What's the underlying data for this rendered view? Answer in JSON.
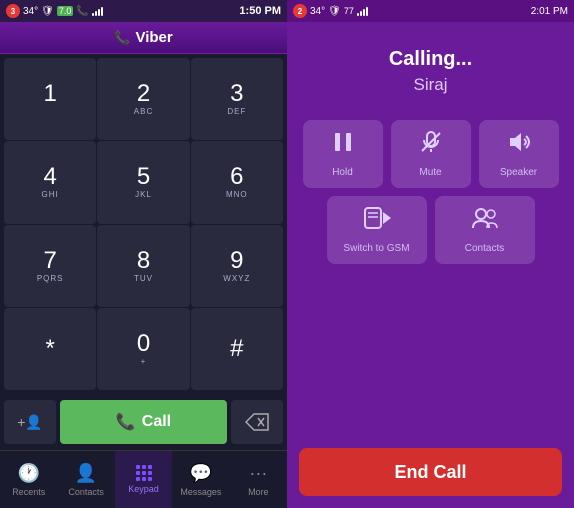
{
  "left": {
    "statusBar": {
      "badge": "3",
      "temp": "34°",
      "shield": "7.0",
      "signal": "full",
      "time": "1:50 PM"
    },
    "header": {
      "appName": "Viber"
    },
    "keypad": {
      "keys": [
        {
          "main": "1",
          "sub": ""
        },
        {
          "main": "2",
          "sub": "ABC"
        },
        {
          "main": "3",
          "sub": "DEF"
        },
        {
          "main": "4",
          "sub": "GHI"
        },
        {
          "main": "5",
          "sub": "JKL"
        },
        {
          "main": "6",
          "sub": "MNO"
        },
        {
          "main": "7",
          "sub": "PQRS"
        },
        {
          "main": "8",
          "sub": "TUV"
        },
        {
          "main": "9",
          "sub": "WXYZ"
        },
        {
          "main": "*",
          "sub": ""
        },
        {
          "main": "0",
          "sub": "+"
        },
        {
          "main": "#",
          "sub": ""
        }
      ]
    },
    "actions": {
      "addContact": "+",
      "call": "Call",
      "backspace": "⌫"
    },
    "nav": {
      "items": [
        {
          "label": "Recents",
          "icon": "clock",
          "active": false
        },
        {
          "label": "Contacts",
          "icon": "person",
          "active": false
        },
        {
          "label": "Keypad",
          "icon": "keypad",
          "active": true
        },
        {
          "label": "Messages",
          "icon": "chat",
          "active": false
        },
        {
          "label": "More",
          "icon": "dots",
          "active": false
        }
      ]
    }
  },
  "right": {
    "statusBar": {
      "badge": "2",
      "temp": "34°",
      "signal": "77",
      "time": "2:01 PM"
    },
    "calling": {
      "title": "Calling...",
      "name": "Siraj"
    },
    "controls": {
      "row1": [
        {
          "label": "Hold",
          "icon": "pause"
        },
        {
          "label": "Mute",
          "icon": "mic-off"
        },
        {
          "label": "Speaker",
          "icon": "volume"
        }
      ],
      "row2": [
        {
          "label": "Switch to GSM",
          "icon": "phone-switch"
        },
        {
          "label": "Contacts",
          "icon": "contacts"
        }
      ]
    },
    "endCall": "End Call"
  }
}
